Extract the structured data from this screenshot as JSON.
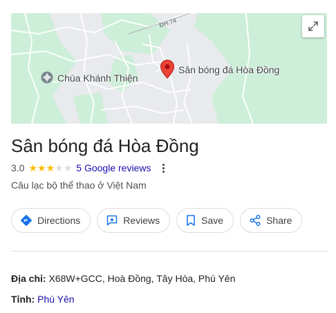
{
  "map": {
    "place_label": "Sân bóng đá Hòa Đồng",
    "poi_label": "Chùa Khánh Thiện",
    "road_label": "ĐH.74"
  },
  "place": {
    "title": "Sân bóng đá Hòa Đồng",
    "rating": "3.0",
    "rating_value": 3,
    "rating_max": 5,
    "reviews_label": "5 Google reviews",
    "category": "Câu lạc bộ thể thao ở Việt Nam"
  },
  "actions": [
    {
      "label": "Directions",
      "icon": "directions-icon"
    },
    {
      "label": "Reviews",
      "icon": "reviews-icon"
    },
    {
      "label": "Save",
      "icon": "bookmark-icon"
    },
    {
      "label": "Share",
      "icon": "share-icon"
    }
  ],
  "details": {
    "address_label": "Địa chỉ:",
    "address_value": "X68W+GCC, Hoà Đồng, Tây Hòa, Phú Yên",
    "province_label": "Tỉnh:",
    "province_value": "Phú Yên"
  },
  "colors": {
    "accent_link": "#1a0dab",
    "star": "#fbbc04",
    "pin": "#ea4335",
    "map_green": "#c8ecd3"
  }
}
